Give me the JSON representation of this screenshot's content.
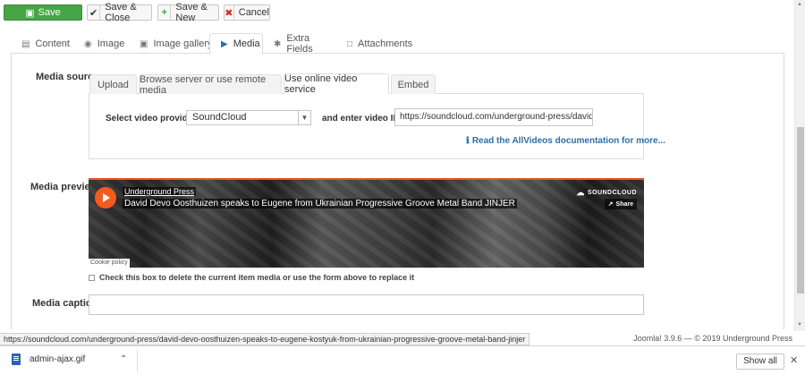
{
  "toolbar": {
    "save": "Save",
    "save_close": "Save & Close",
    "save_new": "Save & New",
    "cancel": "Cancel",
    "save_color": "#46a546"
  },
  "tabs": [
    {
      "label": "Content",
      "icon": "document-icon"
    },
    {
      "label": "Image",
      "icon": "camera-icon"
    },
    {
      "label": "Image gallery",
      "icon": "gallery-icon"
    },
    {
      "label": "Media",
      "icon": "media-icon",
      "active": true
    },
    {
      "label": "Extra Fields",
      "icon": "puzzle-icon"
    },
    {
      "label": "Attachments",
      "icon": "attachment-icon"
    }
  ],
  "media_source": {
    "label": "Media source",
    "tabs": [
      "Upload",
      "Browse server or use remote media",
      "Use online video service",
      "Embed"
    ],
    "active_tab": "Use online video service",
    "provider_label": "Select video provider",
    "provider_value": "SoundCloud",
    "video_id_label": "and enter video ID",
    "video_id_value": "https://soundcloud.com/underground-press/david-devo-oosthui",
    "doc_link": "Read the AllVideos documentation for more..."
  },
  "media_preview": {
    "label": "Media preview",
    "uploader": "Underground Press",
    "title": "David Devo Oosthuizen speaks to Eugene from Ukrainian Progressive Groove Metal Band JINJER",
    "brand": "SOUNDCLOUD",
    "share": "Share",
    "cookie": "Cookie policy",
    "accent_color": "#f55a1d"
  },
  "delete_checkbox_label": "Check this box to delete the current item media or use the form above to replace it",
  "media_caption_label": "Media caption",
  "status_url": "https://soundcloud.com/underground-press/david-devo-oosthuizen-speaks-to-eugene-kostyuk-from-ukrainian-progressive-groove-metal-band-jinjer",
  "footer": "Joomla! 3.9.6 — © 2019 Underground Press",
  "download": {
    "file_name": "admin-ajax.gif",
    "show_all": "Show all"
  }
}
